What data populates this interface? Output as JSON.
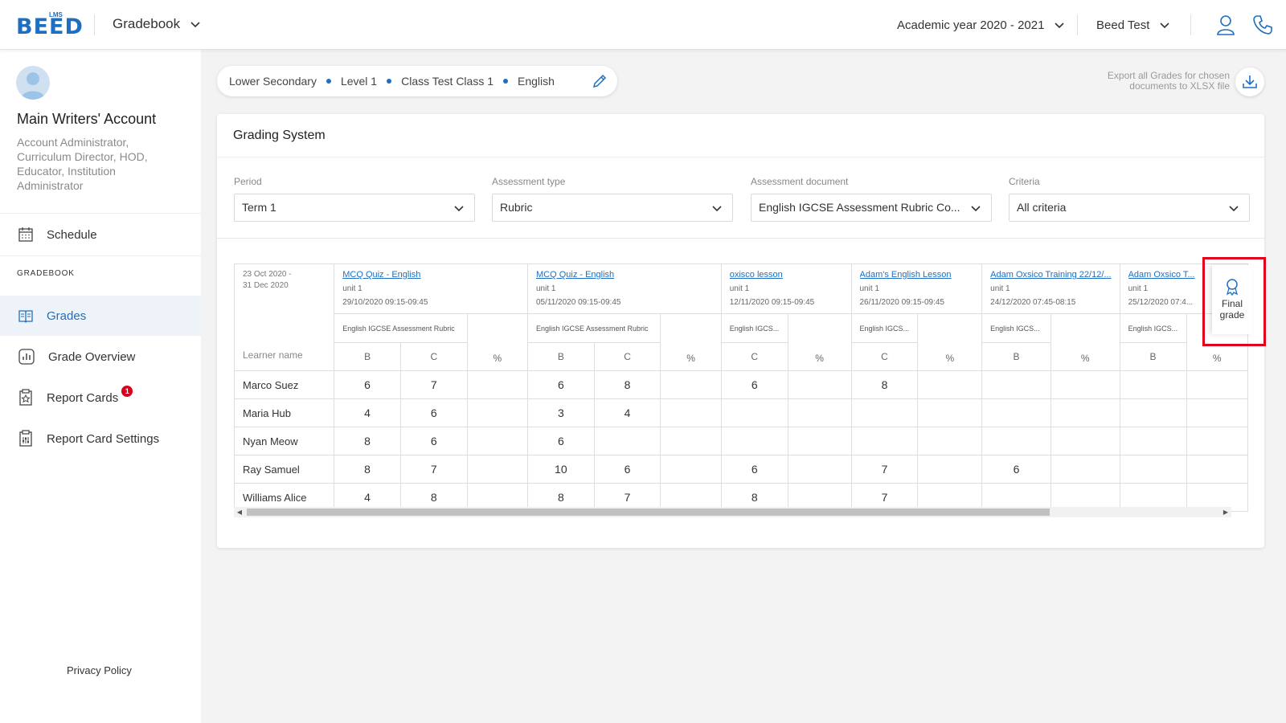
{
  "header": {
    "logo_text": "BEED",
    "logo_sub": "LMS",
    "app_title": "Gradebook",
    "academic_year": "Academic year 2020 - 2021",
    "user_name": "Beed Test"
  },
  "sidebar": {
    "account_name": "Main Writers' Account",
    "account_roles": "Account Administrator, Curriculum Director, HOD, Educator, Institution Administrator",
    "schedule": "Schedule",
    "section_label": "GRADEBOOK",
    "items": [
      {
        "label": "Grades",
        "icon": "book-open-icon"
      },
      {
        "label": "Grade Overview",
        "icon": "chart-icon"
      },
      {
        "label": "Report Cards",
        "icon": "report-card-icon",
        "badge": "1"
      },
      {
        "label": "Report Card Settings",
        "icon": "settings-doc-icon"
      }
    ],
    "privacy": "Privacy Policy"
  },
  "breadcrumb": [
    "Lower Secondary",
    "Level 1",
    "Class Test Class 1",
    "English"
  ],
  "export": {
    "line1": "Export all Grades for chosen",
    "line2": "documents to XLSX file"
  },
  "grading": {
    "title": "Grading System",
    "filters": [
      {
        "label": "Period",
        "value": "Term 1"
      },
      {
        "label": "Assessment type",
        "value": "Rubric"
      },
      {
        "label": "Assessment document",
        "value": "English IGCSE Assessment Rubric Co..."
      },
      {
        "label": "Criteria",
        "value": "All criteria"
      }
    ]
  },
  "table": {
    "period_start": "23 Oct 2020 -",
    "period_end": "31 Dec 2020",
    "learner_header": "Learner name",
    "documents": [
      {
        "title": "MCQ Quiz - English",
        "unit": "unit 1",
        "date": "29/10/2020 09:15-09:45",
        "rubric": "English IGCSE Assessment Rubric",
        "criteria": [
          "B",
          "C"
        ],
        "pct": "%"
      },
      {
        "title": "MCQ Quiz - English",
        "unit": "unit 1",
        "date": "05/11/2020 09:15-09:45",
        "rubric": "English IGCSE Assessment Rubric",
        "criteria": [
          "B",
          "C"
        ],
        "pct": "%"
      },
      {
        "title": "oxisco lesson",
        "unit": "unit 1",
        "date": "12/11/2020 09:15-09:45",
        "rubric": "English IGCS...",
        "criteria": [
          "C"
        ],
        "pct": "%"
      },
      {
        "title": "Adam's English Lesson",
        "unit": "unit 1",
        "date": "26/11/2020 09:15-09:45",
        "rubric": "English IGCS...",
        "criteria": [
          "C"
        ],
        "pct": "%"
      },
      {
        "title": "Adam Oxsico Training 22/12/...",
        "unit": "unit 1",
        "date": "24/12/2020 07:45-08:15",
        "rubric": "English IGCS...",
        "criteria": [
          "B"
        ],
        "pct": "%"
      },
      {
        "title": "Adam Oxsico T...",
        "unit": "unit 1",
        "date": "25/12/2020 07:4...",
        "rubric": "English IGCS...",
        "criteria": [
          "B"
        ],
        "pct": "%"
      }
    ],
    "learners": [
      {
        "name": "Marco Suez",
        "values": [
          "6",
          "7",
          "",
          "6",
          "8",
          "",
          "6",
          "",
          "8",
          "",
          "",
          "",
          "",
          ""
        ]
      },
      {
        "name": "Maria Hub",
        "values": [
          "4",
          "6",
          "",
          "3",
          "4",
          "",
          "",
          "",
          "",
          "",
          "",
          "",
          "",
          ""
        ]
      },
      {
        "name": "Nyan Meow",
        "values": [
          "8",
          "6",
          "",
          "6",
          "",
          "",
          "",
          "",
          "",
          "",
          "",
          "",
          "",
          ""
        ]
      },
      {
        "name": "Ray Samuel",
        "values": [
          "8",
          "7",
          "",
          "10",
          "6",
          "",
          "6",
          "",
          "7",
          "",
          "6",
          "",
          "",
          ""
        ]
      },
      {
        "name": "Williams Alice",
        "values": [
          "4",
          "8",
          "",
          "8",
          "7",
          "",
          "8",
          "",
          "7",
          "",
          "",
          "",
          "",
          ""
        ]
      }
    ]
  },
  "final_grade": {
    "line1": "Final",
    "line2": "grade",
    "icon": "award-icon"
  }
}
